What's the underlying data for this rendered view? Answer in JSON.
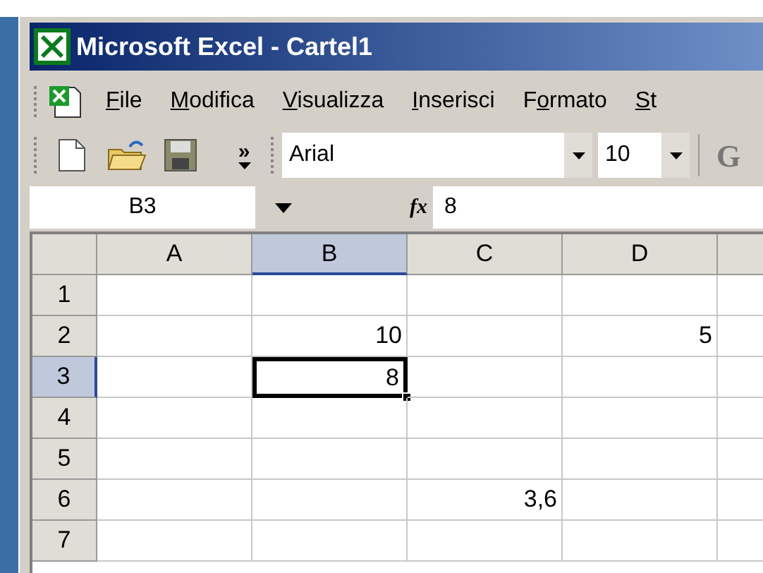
{
  "window": {
    "title": "Microsoft Excel - Cartel1"
  },
  "menu": [
    {
      "parts": [
        {
          "text": "F",
          "underlined": true
        },
        {
          "text": "ile",
          "underlined": false
        }
      ]
    },
    {
      "parts": [
        {
          "text": "M",
          "underlined": true
        },
        {
          "text": "odifica",
          "underlined": false
        }
      ]
    },
    {
      "parts": [
        {
          "text": "V",
          "underlined": true
        },
        {
          "text": "isualizza",
          "underlined": false
        }
      ]
    },
    {
      "parts": [
        {
          "text": "I",
          "underlined": true
        },
        {
          "text": "nserisci",
          "underlined": false
        }
      ]
    },
    {
      "parts": [
        {
          "text": "F",
          "underlined": false
        },
        {
          "text": "o",
          "underlined": true
        },
        {
          "text": "rmato",
          "underlined": false
        }
      ]
    },
    {
      "parts": [
        {
          "text": "S",
          "underlined": true
        },
        {
          "text": "t",
          "underlined": false
        }
      ]
    }
  ],
  "toolbar": {
    "overflow": "»",
    "font": "Arial",
    "size": "10",
    "bold": "G"
  },
  "formula_bar": {
    "name_box": "B3",
    "fx": "fx",
    "value": "8"
  },
  "sheet": {
    "columns": [
      {
        "label": "A",
        "selected": false
      },
      {
        "label": "B",
        "selected": true
      },
      {
        "label": "C",
        "selected": false
      },
      {
        "label": "D",
        "selected": false
      },
      {
        "selected": false
      }
    ],
    "rows": [
      {
        "label": "1",
        "selected": false,
        "cells": [
          {
            "selected": false
          },
          {
            "selected": false
          },
          {
            "selected": false
          },
          {
            "selected": false
          },
          {
            "selected": false
          }
        ]
      },
      {
        "label": "2",
        "selected": false,
        "cells": [
          {
            "selected": false
          },
          {
            "text": "10",
            "selected": false
          },
          {
            "selected": false
          },
          {
            "text": "5",
            "selected": false
          },
          {
            "selected": false
          }
        ]
      },
      {
        "label": "3",
        "selected": true,
        "cells": [
          {
            "selected": false
          },
          {
            "text": "8",
            "selected": true
          },
          {
            "selected": false
          },
          {
            "selected": false
          },
          {
            "selected": false
          }
        ]
      },
      {
        "label": "4",
        "selected": false,
        "cells": [
          {
            "selected": false
          },
          {
            "selected": false
          },
          {
            "selected": false
          },
          {
            "selected": false
          },
          {
            "selected": false
          }
        ]
      },
      {
        "label": "5",
        "selected": false,
        "cells": [
          {
            "selected": false
          },
          {
            "selected": false
          },
          {
            "selected": false
          },
          {
            "selected": false
          },
          {
            "selected": false
          }
        ]
      },
      {
        "label": "6",
        "selected": false,
        "cells": [
          {
            "selected": false
          },
          {
            "selected": false
          },
          {
            "text": "3,6",
            "selected": false
          },
          {
            "selected": false
          },
          {
            "selected": false
          }
        ]
      },
      {
        "label": "7",
        "selected": false,
        "cells": [
          {
            "selected": false
          },
          {
            "selected": false
          },
          {
            "selected": false
          },
          {
            "selected": false
          },
          {
            "selected": false
          }
        ]
      }
    ]
  }
}
